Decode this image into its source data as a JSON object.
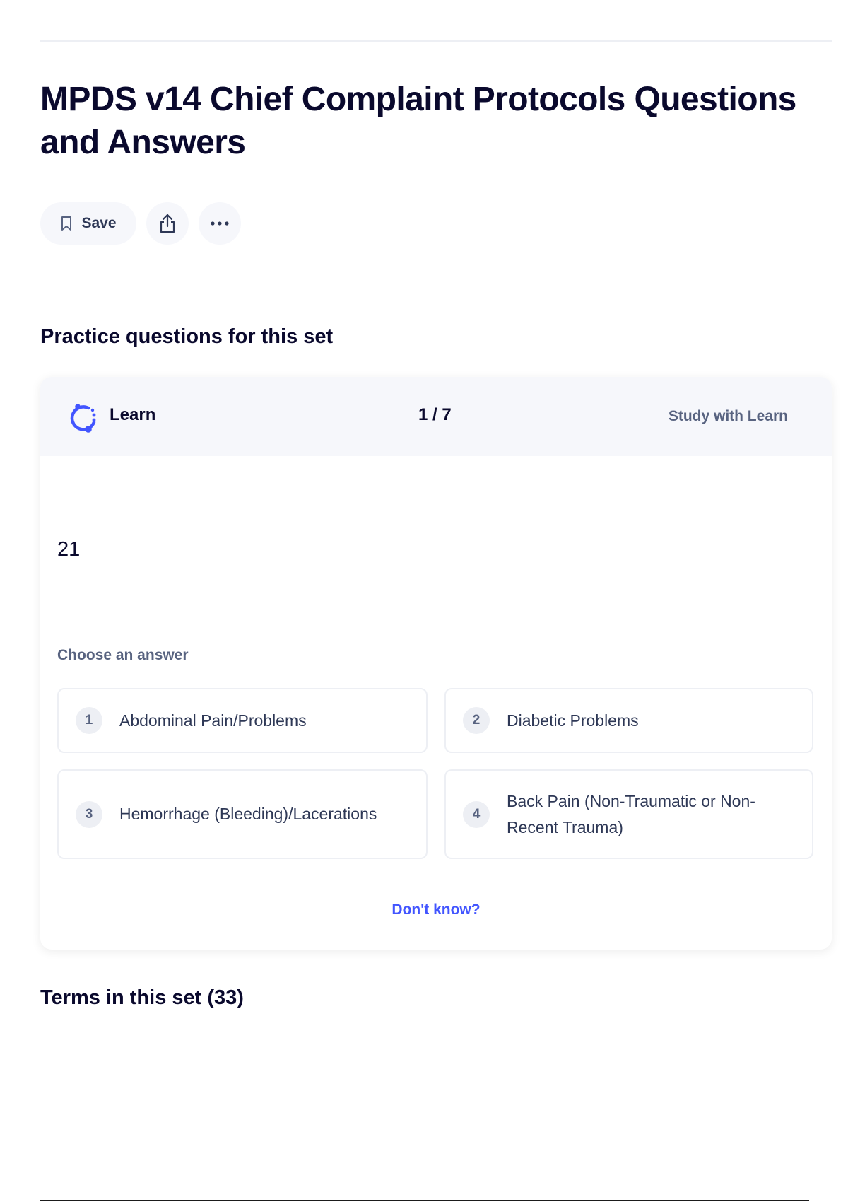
{
  "page": {
    "title": "MPDS v14 Chief Complaint Protocols Questions and Answers"
  },
  "actions": {
    "save_label": "Save"
  },
  "practice": {
    "section_title": "Practice questions for this set",
    "mode_label": "Learn",
    "counter": "1 / 7",
    "study_link": "Study with Learn",
    "prompt": "21",
    "choose_label": "Choose an answer",
    "options": [
      {
        "number": "1",
        "text": "Abdominal Pain/Problems"
      },
      {
        "number": "2",
        "text": "Diabetic Problems"
      },
      {
        "number": "3",
        "text": "Hemorrhage (Bleeding)/Lacerations"
      },
      {
        "number": "4",
        "text": "Back Pain (Non-Traumatic or Non-Recent Trauma)"
      }
    ],
    "dont_know": "Don't know?"
  },
  "terms": {
    "section_title": "Terms in this set (33)"
  },
  "colors": {
    "accent": "#4255ff",
    "text_primary": "#0a092d",
    "text_secondary": "#586380",
    "surface": "#f6f7fb",
    "border": "#edeff4"
  },
  "icons": {
    "save": "bookmark-icon",
    "share": "share-icon",
    "more": "more-horizontal-icon",
    "learn": "learn-mode-icon"
  }
}
